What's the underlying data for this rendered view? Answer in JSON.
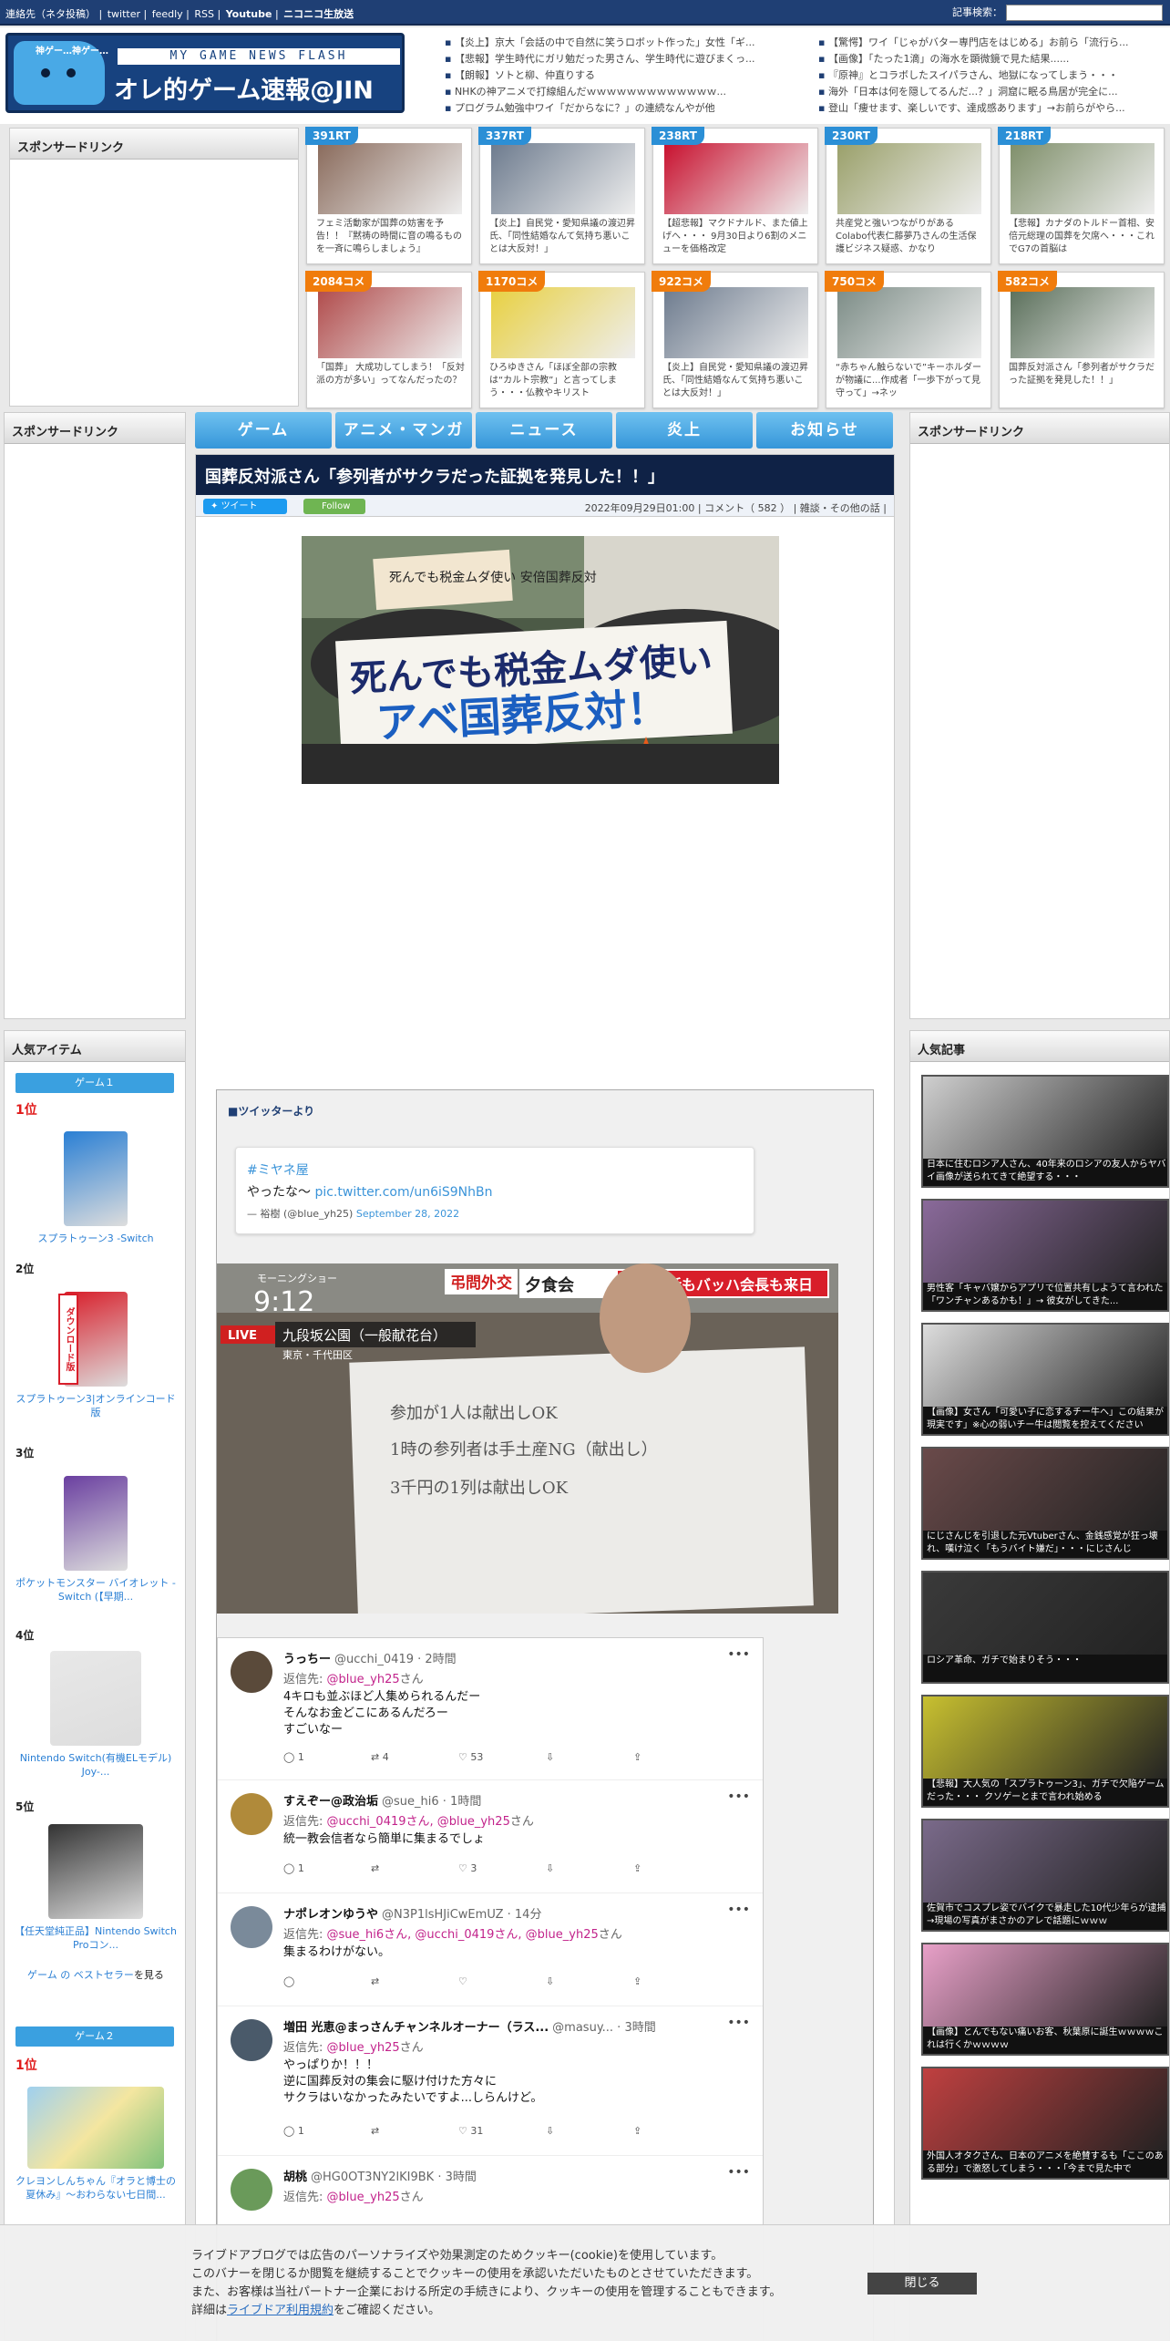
{
  "topbar": {
    "links": [
      "連絡先（ネタ投稿）",
      "twitter",
      "feedly",
      "RSS",
      "Youtube",
      "ニコニコ生放送"
    ],
    "search_label": "記事検索："
  },
  "logo": {
    "kami": "神ゲー…神ゲー…",
    "subtitle": "MY GAME NEWS FLASH",
    "title": "オレ的ゲーム速報@JIN"
  },
  "headlines": {
    "left": [
      "【炎上】京大「会話の中で自然に笑うロボット作った」女性「ギ...",
      "【悲報】学生時代にガリ勉だった男さん、学生時代に遊びまくっ...",
      "【朗報】ソトと柳、仲直りする",
      "NHKの神アニメで打線組んだｗｗｗｗｗｗｗｗｗｗｗｗｗ...",
      "プログラム勉強中ワイ「だからなに？」の連続なんやが他"
    ],
    "right": [
      "【驚愕】ワイ「じゃがバター専門店をはじめる」お前ら「流行ら...",
      "【画像】「たった1滴」の海水を顕微鏡で見た結果......",
      "『原神』とコラボしたスイパラさん、地獄になってしまう・・・",
      "海外「日本は何を隠してるんだ...？」洞窟に眠る鳥居が完全に...",
      "登山「痩せます、楽しいです、達成感あります」→お前らがやら..."
    ]
  },
  "sponsor_label": "スポンサードリンク",
  "rt_top": [
    {
      "badge": "391RT",
      "caption": "フェミ活動家が国葬の妨害を予告！！『黙祷の時間に音の鳴るものを一斉に鳴らしましょう』",
      "color": "#8a6b5c"
    },
    {
      "badge": "337RT",
      "caption": "【炎上】自民党・愛知県議の渡辺昇氏、「同性結婚なんて気持ち悪いことは大反対！」",
      "color": "#6d7b8e"
    },
    {
      "badge": "238RT",
      "caption": "【超悲報】マクドナルド、また値上げへ・・・ 9月30日より6割のメニューを価格改定",
      "color": "#c8102e"
    },
    {
      "badge": "230RT",
      "caption": "共産党と強いつながりがあるColabo代表仁藤夢乃さんの生活保護ビジネス疑惑、かなり",
      "color": "#9aa06a"
    },
    {
      "badge": "218RT",
      "caption": "【悲報】カナダのトルドー首相、安倍元総理の国葬を欠席へ・・・これでG7の首脳は",
      "color": "#7f8f6a"
    }
  ],
  "rt_bottom": [
    {
      "badge": "2084コメ",
      "caption": "「国葬」 大成功してしまう！「反対派の方が多い」ってなんだったの？",
      "color": "#b04a4a"
    },
    {
      "badge": "1170コメ",
      "caption": "ひろゆきさん「ほぼ全部の宗教は“カルト宗教”」と言ってしまう・・・仏教やキリスト",
      "color": "#e8d040"
    },
    {
      "badge": "922コメ",
      "caption": "【炎上】自民党・愛知県議の渡辺昇氏、「同性結婚なんて気持ち悪いことは大反対！」",
      "color": "#6d7b8e"
    },
    {
      "badge": "750コメ",
      "caption": "“赤ちゃん触らないで”キーホルダーが物議に...作成者「一歩下がって見守って」→ネッ",
      "color": "#7c8c86"
    },
    {
      "badge": "582コメ",
      "caption": "国葬反対派さん「参列者がサクラだった証拠を発見した！！」",
      "color": "#5a6f5a"
    }
  ],
  "nav_tabs": [
    "ゲーム",
    "アニメ・マンガ",
    "ニュース",
    "炎上",
    "お知らせ"
  ],
  "article": {
    "title": "国葬反対派さん「参列者がサクラだった証拠を発見した！！」",
    "tweet_btn": "ツイート",
    "follow_btn": "Follow",
    "date": "2022年09月29日01:00",
    "comment_label": "コメント",
    "comment_count": "582",
    "category": "雑談・その他の話",
    "sign_line1": "死んでも税金ムダ使い",
    "sign_line2": "アベ国葬反対！",
    "sign_small": "死んでも税金ムダ使い 安倍国葬反対"
  },
  "embed": {
    "from": "■ツイッターより",
    "tag": "#ミヤネ屋",
    "text": "やったな～",
    "link": "pic.twitter.com/un6iS9NhBn",
    "author": "— 裕樹 (@blue_yh25)",
    "date": "September 28, 2022",
    "tv_program": "モーニングショー",
    "tv_time": "9:12",
    "tv_live": "LIVE",
    "tv_location": "九段坂公園（一般献花台）",
    "tv_ward": "東京・千代田区",
    "tv_red_tag": "弔問外交",
    "tv_headline_a": "夕食会",
    "tv_headline_b": "思い出話もバッハ会長も来日",
    "memo_line1": "参加が1人は献出しOK",
    "memo_line2": "1時の参列者は手土産NG（献出し）",
    "memo_line3": "3千円の1列は献出しOK"
  },
  "replies": [
    {
      "name": "うっちー",
      "handle": "@ucchi_0419 · 2時間",
      "to_label": "返信先:",
      "to": "@blue_yh25",
      "suffix": "さん",
      "text": [
        "4キロも並ぶほど人集められるんだー",
        "そんなお金どこにあるんだろー",
        "すごいなー"
      ],
      "reply": "1",
      "rt": "4",
      "like": "53",
      "avcolor": "#5a4a3a"
    },
    {
      "name": "すえぞー@政治垢",
      "handle": "@sue_hi6 · 1時間",
      "to_label": "返信先:",
      "to": "@ucchi_0419さん, @blue_yh25",
      "suffix": "さん",
      "text": [
        "統一教会信者なら簡単に集まるでしょ"
      ],
      "reply": "1",
      "rt": "",
      "like": "3",
      "avcolor": "#b08a3a"
    },
    {
      "name": "ナポレオンゆうや",
      "handle": "@N3P1lsHJiCwEmUZ · 14分",
      "to_label": "返信先:",
      "to": "@sue_hi6さん, @ucchi_0419さん, @blue_yh25",
      "suffix": "さん",
      "text": [
        "集まるわけがない。"
      ],
      "reply": "",
      "rt": "",
      "like": "",
      "avcolor": "#7a8a9a"
    },
    {
      "name": "増田 光恵@まっさんチャンネルオーナー（ラス...",
      "handle": "@masuy... · 3時間",
      "to_label": "返信先:",
      "to": "@blue_yh25",
      "suffix": "さん",
      "text": [
        "やっぱりか！！！",
        "逆に国葬反対の集会に駆け付けた方々に",
        "サクラはいなかったみたいですよ...しらんけど。"
      ],
      "reply": "1",
      "rt": "",
      "like": "31",
      "avcolor": "#4a5a6a"
    },
    {
      "name": "胡桃",
      "handle": "@HG0OT3NY2lKI9BK · 3時間",
      "to_label": "返信先:",
      "to": "@blue_yh25",
      "suffix": "さん",
      "text": [],
      "reply": "",
      "rt": "",
      "like": "",
      "avcolor": "#6a9a5a"
    }
  ],
  "left_side": {
    "title": "人気アイテム",
    "group1": "ゲーム１",
    "group2": "ゲーム２",
    "items": [
      {
        "rank": "1位",
        "name": "スプラトゥーン3 -Switch",
        "color": "#2a7fd4"
      },
      {
        "rank": "2位",
        "name": "スプラトゥーン3|オンラインコード版",
        "color": "#d81e2a"
      },
      {
        "rank": "3位",
        "name": "ポケットモンスター バイオレット -Switch (【早期...",
        "color": "#6a3fa0"
      },
      {
        "rank": "4位",
        "name": "Nintendo Switch(有機ELモデル) Joy-...",
        "color": "#e8e8e8"
      },
      {
        "rank": "5位",
        "name": "【任天堂純正品】Nintendo Switch Proコン...",
        "color": "#333333"
      }
    ],
    "bestseller_link": "ゲーム の ベストセラー",
    "bestseller_suffix": "を見る",
    "group2_rank": "1位",
    "group2_item": "クレヨンしんちゃん『オラと博士の夏休み』～おわらない七日間...",
    "download_label": "ダウンロード版"
  },
  "popular": {
    "title": "人気記事",
    "items": [
      {
        "caption": "日本に住むロシア人さん、40年来のロシアの友人からヤバイ画像が送られてきて絶望する・・・",
        "color": "#cfcfcf"
      },
      {
        "caption": "男性客「キャバ嬢からアプリで位置共有しようて言われた「ワンチャンあるかも！」→ 彼女がしてきた...",
        "color": "#8a6a9a"
      },
      {
        "caption": "【画像】女さん「可愛い子に恋するチー牛へ」この結果が現実です」※心の弱いチー牛は閲覧を控えてください",
        "color": "#dddddd"
      },
      {
        "caption": "にじさんじを引退した元Vtuberさん、金銭感覚が狂っ壊れ、嘆け泣く「もうバイト嫌だ」・・・にじさんじ",
        "color": "#6a4a4a"
      },
      {
        "caption": "ロシア革命、ガチで始まりそう・・・",
        "color": "#3a3a3a"
      },
      {
        "caption": "【悲報】大人気の「スプラトゥーン3」、ガチで欠陥ゲームだった・・・ クソゲーとまで言われ始める",
        "color": "#c8c030"
      },
      {
        "caption": "佐賀市でコスプレ姿でバイクで暴走した10代少年らが逮捕→現場の写真がまさかのアレで話題にｗｗｗ",
        "color": "#7a6a8a"
      },
      {
        "caption": "【画像】とんでもない痛いお客、秋葉原に誕生ｗｗｗｗこれは行くかｗｗｗｗ",
        "color": "#e8a0c8"
      },
      {
        "caption": "外国人オタクさん、日本のアニメを絶賛するも「ここのある部分」で激怒してしまう・・・「今まで見た中で",
        "color": "#c04040"
      }
    ]
  },
  "cookie": {
    "line1": "ライブドアブログでは広告のパーソナライズや効果測定のためクッキー(cookie)を使用しています。",
    "line2": "このバナーを閉じるか閲覧を継続することでクッキーの使用を承認いただいたものとさせていただきます。",
    "line3": "また、お客様は当社パートナー企業における所定の手続きにより、クッキーの使用を管理することもできます。",
    "line4_pre": "詳細は",
    "line4_link": "ライブドア利用規約",
    "line4_post": "をご確認ください。",
    "close": "閉じる"
  },
  "colors": {
    "topbar": "#1f3f74",
    "article_title_bg": "#0f2246",
    "nav_tab": "#3596d9",
    "rt_blue": "#2b8fd6",
    "rt_orange": "#f07c0c",
    "rank_red": "#e01b1b",
    "link_blue": "#3b94d9",
    "reply_handle": "#c2238b"
  }
}
